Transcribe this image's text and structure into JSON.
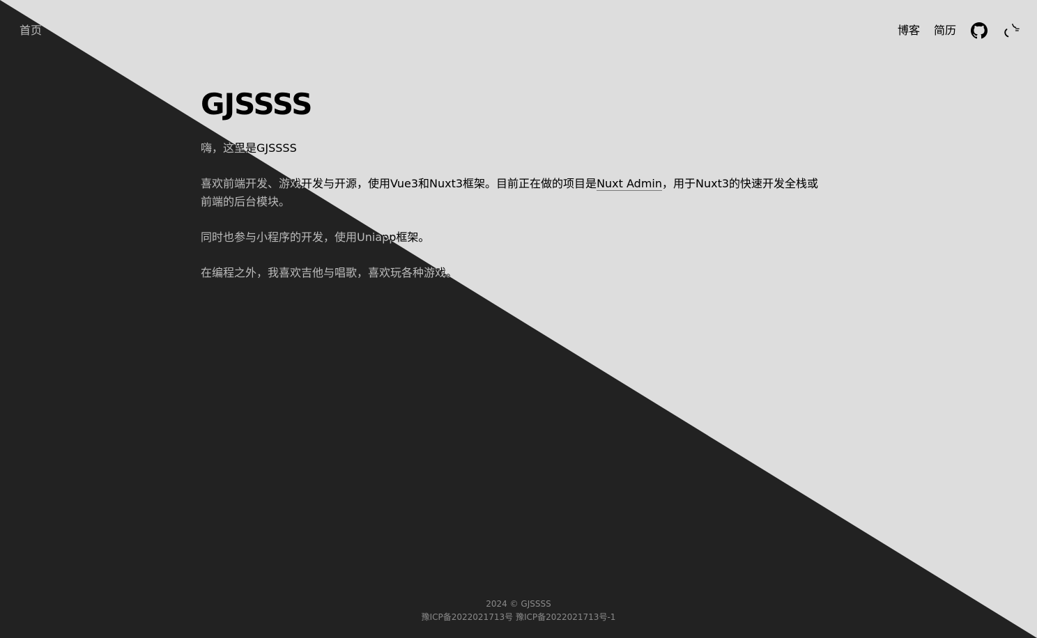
{
  "nav": {
    "home_label": "首页",
    "blog_label": "博客",
    "resume_label": "简历",
    "github_icon": "github-icon",
    "theme_icon": "theme-toggle-icon"
  },
  "main": {
    "title": "GJSSSS",
    "intro": "嗨，这里是GJSSSS",
    "p2_before": "喜欢前端开发、游戏开发与开源，使用Vue3和Nuxt3框架。目前正在做的项目是",
    "p2_link": "Nuxt Admin",
    "p2_after": "，用于Nuxt3的快速开发全栈或前端的后台模块。",
    "p3": "同时也参与小程序的开发，使用Uniapp框架。",
    "p4": "在编程之外，我喜欢吉他与唱歌，喜欢玩各种游戏。"
  },
  "footer": {
    "copyright": "2024 © GJSSSS",
    "icp1": "豫ICP备2022021713号",
    "icp2": "豫ICP备2022021713号-1"
  },
  "colors": {
    "light": "#dddddd",
    "dark": "#222222",
    "footer_text": "#8a8a8a"
  }
}
